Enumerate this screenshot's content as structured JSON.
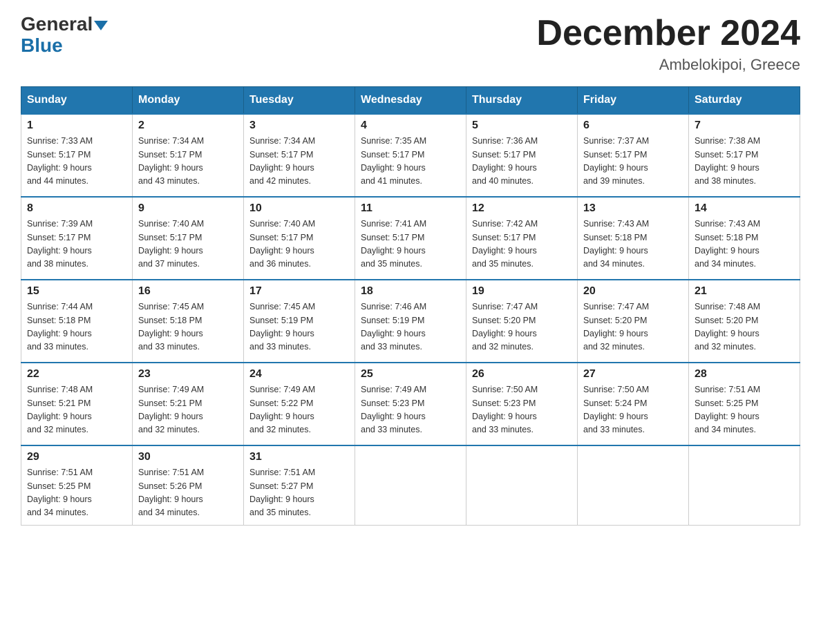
{
  "header": {
    "logo_general": "General",
    "logo_blue": "Blue",
    "month_title": "December 2024",
    "location": "Ambelokipoi, Greece"
  },
  "days_of_week": [
    "Sunday",
    "Monday",
    "Tuesday",
    "Wednesday",
    "Thursday",
    "Friday",
    "Saturday"
  ],
  "weeks": [
    [
      {
        "day": "1",
        "sunrise": "7:33 AM",
        "sunset": "5:17 PM",
        "daylight": "9 hours and 44 minutes."
      },
      {
        "day": "2",
        "sunrise": "7:34 AM",
        "sunset": "5:17 PM",
        "daylight": "9 hours and 43 minutes."
      },
      {
        "day": "3",
        "sunrise": "7:34 AM",
        "sunset": "5:17 PM",
        "daylight": "9 hours and 42 minutes."
      },
      {
        "day": "4",
        "sunrise": "7:35 AM",
        "sunset": "5:17 PM",
        "daylight": "9 hours and 41 minutes."
      },
      {
        "day": "5",
        "sunrise": "7:36 AM",
        "sunset": "5:17 PM",
        "daylight": "9 hours and 40 minutes."
      },
      {
        "day": "6",
        "sunrise": "7:37 AM",
        "sunset": "5:17 PM",
        "daylight": "9 hours and 39 minutes."
      },
      {
        "day": "7",
        "sunrise": "7:38 AM",
        "sunset": "5:17 PM",
        "daylight": "9 hours and 38 minutes."
      }
    ],
    [
      {
        "day": "8",
        "sunrise": "7:39 AM",
        "sunset": "5:17 PM",
        "daylight": "9 hours and 38 minutes."
      },
      {
        "day": "9",
        "sunrise": "7:40 AM",
        "sunset": "5:17 PM",
        "daylight": "9 hours and 37 minutes."
      },
      {
        "day": "10",
        "sunrise": "7:40 AM",
        "sunset": "5:17 PM",
        "daylight": "9 hours and 36 minutes."
      },
      {
        "day": "11",
        "sunrise": "7:41 AM",
        "sunset": "5:17 PM",
        "daylight": "9 hours and 35 minutes."
      },
      {
        "day": "12",
        "sunrise": "7:42 AM",
        "sunset": "5:17 PM",
        "daylight": "9 hours and 35 minutes."
      },
      {
        "day": "13",
        "sunrise": "7:43 AM",
        "sunset": "5:18 PM",
        "daylight": "9 hours and 34 minutes."
      },
      {
        "day": "14",
        "sunrise": "7:43 AM",
        "sunset": "5:18 PM",
        "daylight": "9 hours and 34 minutes."
      }
    ],
    [
      {
        "day": "15",
        "sunrise": "7:44 AM",
        "sunset": "5:18 PM",
        "daylight": "9 hours and 33 minutes."
      },
      {
        "day": "16",
        "sunrise": "7:45 AM",
        "sunset": "5:18 PM",
        "daylight": "9 hours and 33 minutes."
      },
      {
        "day": "17",
        "sunrise": "7:45 AM",
        "sunset": "5:19 PM",
        "daylight": "9 hours and 33 minutes."
      },
      {
        "day": "18",
        "sunrise": "7:46 AM",
        "sunset": "5:19 PM",
        "daylight": "9 hours and 33 minutes."
      },
      {
        "day": "19",
        "sunrise": "7:47 AM",
        "sunset": "5:20 PM",
        "daylight": "9 hours and 32 minutes."
      },
      {
        "day": "20",
        "sunrise": "7:47 AM",
        "sunset": "5:20 PM",
        "daylight": "9 hours and 32 minutes."
      },
      {
        "day": "21",
        "sunrise": "7:48 AM",
        "sunset": "5:20 PM",
        "daylight": "9 hours and 32 minutes."
      }
    ],
    [
      {
        "day": "22",
        "sunrise": "7:48 AM",
        "sunset": "5:21 PM",
        "daylight": "9 hours and 32 minutes."
      },
      {
        "day": "23",
        "sunrise": "7:49 AM",
        "sunset": "5:21 PM",
        "daylight": "9 hours and 32 minutes."
      },
      {
        "day": "24",
        "sunrise": "7:49 AM",
        "sunset": "5:22 PM",
        "daylight": "9 hours and 32 minutes."
      },
      {
        "day": "25",
        "sunrise": "7:49 AM",
        "sunset": "5:23 PM",
        "daylight": "9 hours and 33 minutes."
      },
      {
        "day": "26",
        "sunrise": "7:50 AM",
        "sunset": "5:23 PM",
        "daylight": "9 hours and 33 minutes."
      },
      {
        "day": "27",
        "sunrise": "7:50 AM",
        "sunset": "5:24 PM",
        "daylight": "9 hours and 33 minutes."
      },
      {
        "day": "28",
        "sunrise": "7:51 AM",
        "sunset": "5:25 PM",
        "daylight": "9 hours and 34 minutes."
      }
    ],
    [
      {
        "day": "29",
        "sunrise": "7:51 AM",
        "sunset": "5:25 PM",
        "daylight": "9 hours and 34 minutes."
      },
      {
        "day": "30",
        "sunrise": "7:51 AM",
        "sunset": "5:26 PM",
        "daylight": "9 hours and 34 minutes."
      },
      {
        "day": "31",
        "sunrise": "7:51 AM",
        "sunset": "5:27 PM",
        "daylight": "9 hours and 35 minutes."
      },
      {
        "day": "",
        "sunrise": "",
        "sunset": "",
        "daylight": ""
      },
      {
        "day": "",
        "sunrise": "",
        "sunset": "",
        "daylight": ""
      },
      {
        "day": "",
        "sunrise": "",
        "sunset": "",
        "daylight": ""
      },
      {
        "day": "",
        "sunrise": "",
        "sunset": "",
        "daylight": ""
      }
    ]
  ],
  "labels": {
    "sunrise": "Sunrise:",
    "sunset": "Sunset:",
    "daylight": "Daylight:"
  }
}
